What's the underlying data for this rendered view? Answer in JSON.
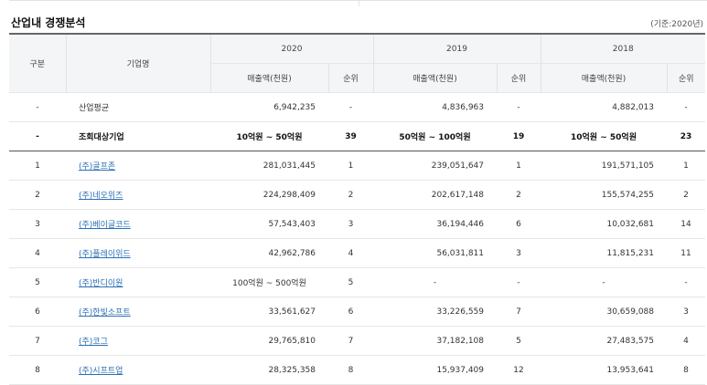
{
  "title": "산업내 경쟁분석",
  "basis": "(기준:2020년)",
  "headers": {
    "group": "구분",
    "company": "기업명",
    "years": [
      "2020",
      "2019",
      "2018"
    ],
    "sales": "매출액(천원)",
    "rank": "순위"
  },
  "summary_rows": [
    {
      "group": "-",
      "name": "산업평균",
      "y2020": "6,942,235",
      "r2020": "-",
      "y2019": "4,836,963",
      "r2019": "-",
      "y2018": "4,882,013",
      "r2018": "-"
    },
    {
      "group": "-",
      "name": "조회대상기업",
      "y2020": "10억원 ~ 50억원",
      "r2020": "39",
      "y2019": "50억원 ~ 100억원",
      "r2019": "19",
      "y2018": "10억원 ~ 50억원",
      "r2018": "23"
    }
  ],
  "rows": [
    {
      "group": "1",
      "name": "(주)골프존",
      "y2020": "281,031,445",
      "r2020": "1",
      "y2019": "239,051,647",
      "r2019": "1",
      "y2018": "191,571,105",
      "r2018": "1"
    },
    {
      "group": "2",
      "name": "(주)네오위즈",
      "y2020": "224,298,409",
      "r2020": "2",
      "y2019": "202,617,148",
      "r2019": "2",
      "y2018": "155,574,255",
      "r2018": "2"
    },
    {
      "group": "3",
      "name": "(주)베이글코드",
      "y2020": "57,543,403",
      "r2020": "3",
      "y2019": "36,194,446",
      "r2019": "6",
      "y2018": "10,032,681",
      "r2018": "14"
    },
    {
      "group": "4",
      "name": "(주)플레이위드",
      "y2020": "42,962,786",
      "r2020": "4",
      "y2019": "56,031,811",
      "r2019": "3",
      "y2018": "11,815,231",
      "r2018": "11"
    },
    {
      "group": "5",
      "name": "(주)반디이원",
      "y2020": "100억원 ~ 500억원",
      "r2020": "5",
      "y2019": "-",
      "r2019": "-",
      "y2018": "-",
      "r2018": "-"
    },
    {
      "group": "6",
      "name": "(주)한빛소프트",
      "y2020": "33,561,627",
      "r2020": "6",
      "y2019": "33,226,559",
      "r2019": "7",
      "y2018": "30,659,088",
      "r2018": "3"
    },
    {
      "group": "7",
      "name": "(주)코그",
      "y2020": "29,765,810",
      "r2020": "7",
      "y2019": "37,182,108",
      "r2019": "5",
      "y2018": "27,483,575",
      "r2018": "4"
    },
    {
      "group": "8",
      "name": "(주)시프트업",
      "y2020": "28,325,358",
      "r2020": "8",
      "y2019": "15,937,409",
      "r2019": "12",
      "y2018": "13,953,641",
      "r2018": "8"
    }
  ]
}
